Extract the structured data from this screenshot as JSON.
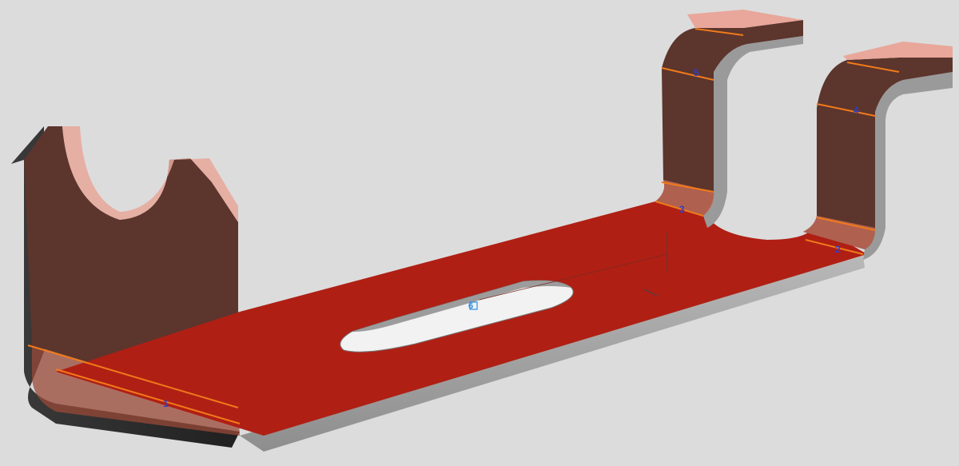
{
  "viewport": {
    "background": "#dcdcdc",
    "colors": {
      "base_face": "#b01f14",
      "face_dark": "#5c352d",
      "face_light": "#e8a79a",
      "steel_edge": "#a9a9a9",
      "bend_line": "#f07a1a",
      "label": "#2e3fcc",
      "origin_marker": "#2f8fe0"
    }
  },
  "bend_labels": [
    {
      "id": "1",
      "text": "1"
    },
    {
      "id": "2",
      "text": "2"
    },
    {
      "id": "3",
      "text": "3"
    },
    {
      "id": "4",
      "text": "4"
    },
    {
      "id": "5",
      "text": "5"
    }
  ],
  "origin_marker": {
    "text": "6",
    "icon": "fixed-face-marker"
  }
}
